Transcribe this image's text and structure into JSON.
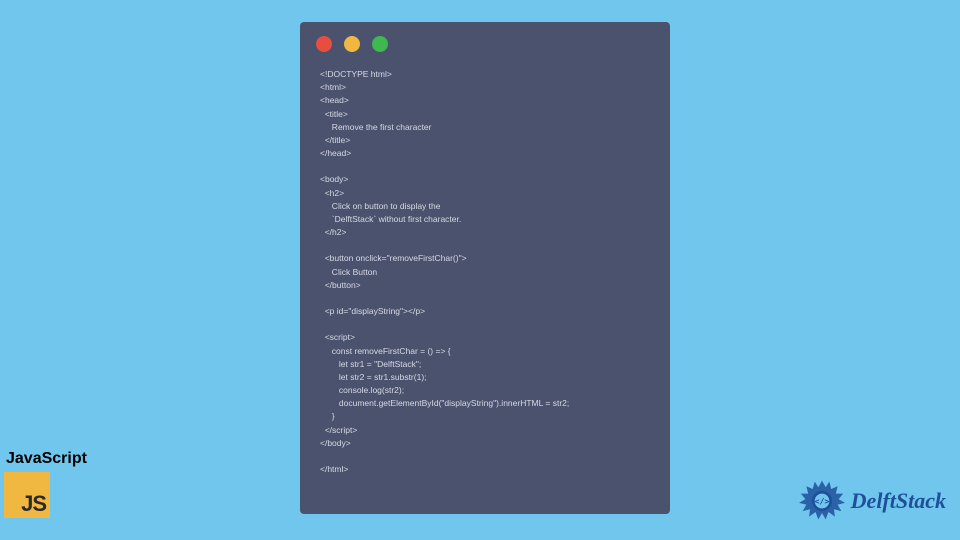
{
  "window": {
    "dots": [
      "red",
      "yellow",
      "green"
    ]
  },
  "code": {
    "content": "<!DOCTYPE html>\n<html>\n<head>\n  <title>\n     Remove the first character\n  </title>\n</head>\n\n<body>\n  <h2>\n     Click on button to display the\n     `DelftStack` without first character.\n  </h2>\n\n  <button onclick=\"removeFirstChar()\">\n     Click Button\n  </button>\n\n  <p id=\"displayString\"></p>\n\n  <script>\n     const removeFirstChar = () => {\n        let str1 = \"DelftStack\";\n        let str2 = str1.substr(1);\n        console.log(str2);\n        document.getElementById(\"displayString\").innerHTML = str2;\n     }\n  </script>\n</body>\n\n</html>"
  },
  "jsBadge": {
    "label": "JavaScript",
    "logoText": "JS"
  },
  "brand": {
    "text": "DelftStack"
  }
}
